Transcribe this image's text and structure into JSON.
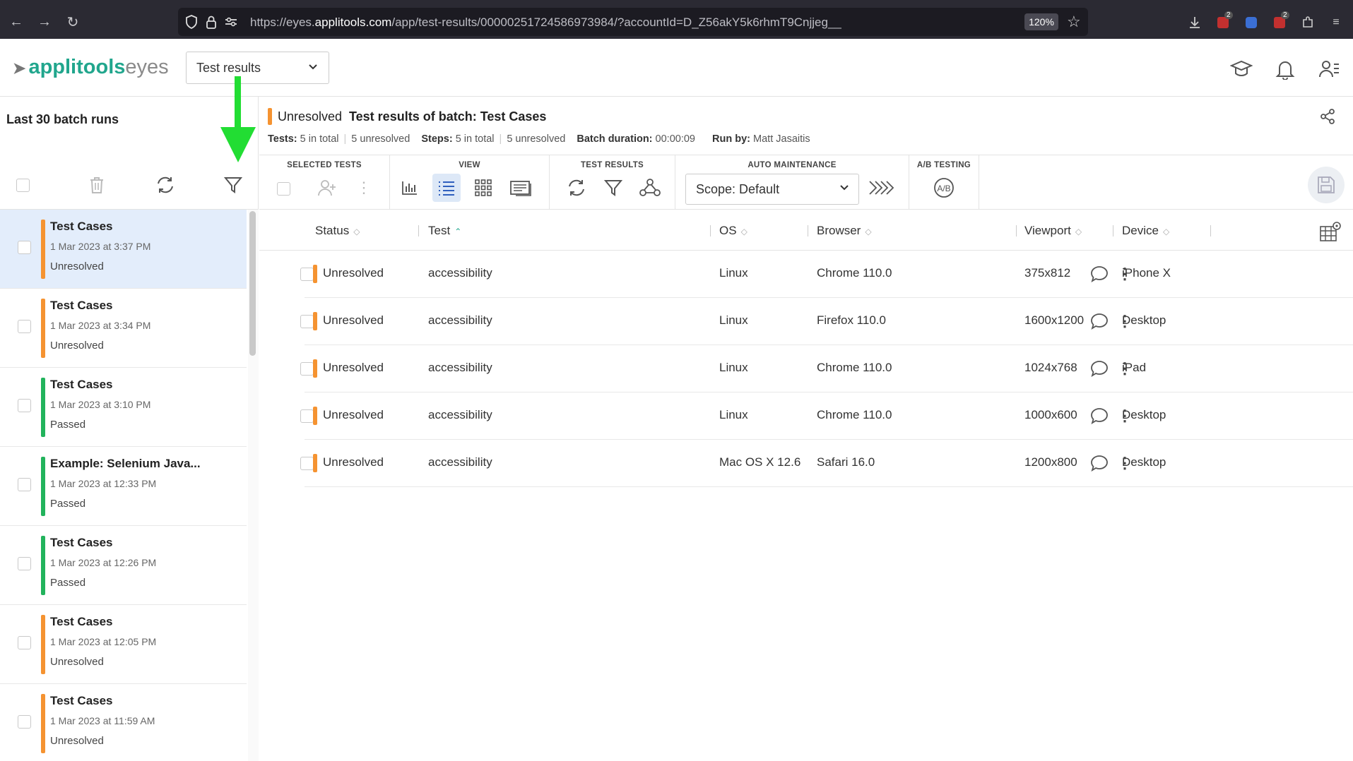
{
  "browser": {
    "url_prefix": "https://eyes.",
    "url_domain": "applitools.com",
    "url_rest": "/app/test-results/00000251724586973984/?accountId=D_Z56akY5k6rhmT9Cnjjeg__",
    "zoom": "120%",
    "ext_badge_1": "2",
    "ext_badge_2": "2"
  },
  "header": {
    "logo_main": "applitools",
    "logo_sub": "eyes",
    "view_select": "Test results"
  },
  "sidebar": {
    "title": "Last 30 batch runs",
    "batches": [
      {
        "name": "Test Cases",
        "date": "1 Mar 2023 at 3:37 PM",
        "status": "Unresolved",
        "color": "#f59331",
        "selected": true
      },
      {
        "name": "Test Cases",
        "date": "1 Mar 2023 at 3:34 PM",
        "status": "Unresolved",
        "color": "#f59331",
        "selected": false
      },
      {
        "name": "Test Cases",
        "date": "1 Mar 2023 at 3:10 PM",
        "status": "Passed",
        "color": "#22b35c",
        "selected": false
      },
      {
        "name": "Example: Selenium Java...",
        "date": "1 Mar 2023 at 12:33 PM",
        "status": "Passed",
        "color": "#22b35c",
        "selected": false
      },
      {
        "name": "Test Cases",
        "date": "1 Mar 2023 at 12:26 PM",
        "status": "Passed",
        "color": "#22b35c",
        "selected": false
      },
      {
        "name": "Test Cases",
        "date": "1 Mar 2023 at 12:05 PM",
        "status": "Unresolved",
        "color": "#f59331",
        "selected": false
      },
      {
        "name": "Test Cases",
        "date": "1 Mar 2023 at 11:59 AM",
        "status": "Unresolved",
        "color": "#f59331",
        "selected": false
      }
    ]
  },
  "batch_header": {
    "status": "Unresolved",
    "title": "Test results of batch:  Test Cases",
    "tests_label": "Tests:",
    "tests_total": "5 in total",
    "tests_unresolved": "5 unresolved",
    "steps_label": "Steps:",
    "steps_total": "5 in total",
    "steps_unresolved": "5 unresolved",
    "duration_label": "Batch duration:",
    "duration": "00:00:09",
    "runby_label": "Run by:",
    "runby": "Matt Jasaitis"
  },
  "toolbar": {
    "selected_tests": "SELECTED TESTS",
    "view": "VIEW",
    "test_results": "TEST RESULTS",
    "auto_maintenance": "AUTO MAINTENANCE",
    "ab_testing": "A/B TESTING",
    "scope": "Scope: Default",
    "ab_icon_text": "A/B"
  },
  "table": {
    "columns": [
      "Status",
      "Test",
      "OS",
      "Browser",
      "Viewport",
      "Device"
    ],
    "rows": [
      {
        "status": "Unresolved",
        "test": "accessibility",
        "os": "Linux",
        "browser": "Chrome 110.0",
        "viewport": "375x812",
        "device": "iPhone X"
      },
      {
        "status": "Unresolved",
        "test": "accessibility",
        "os": "Linux",
        "browser": "Firefox 110.0",
        "viewport": "1600x1200",
        "device": "Desktop"
      },
      {
        "status": "Unresolved",
        "test": "accessibility",
        "os": "Linux",
        "browser": "Chrome 110.0",
        "viewport": "1024x768",
        "device": "iPad"
      },
      {
        "status": "Unresolved",
        "test": "accessibility",
        "os": "Linux",
        "browser": "Chrome 110.0",
        "viewport": "1000x600",
        "device": "Desktop"
      },
      {
        "status": "Unresolved",
        "test": "accessibility",
        "os": "Mac OS X 12.6",
        "browser": "Safari 16.0",
        "viewport": "1200x800",
        "device": "Desktop"
      }
    ]
  },
  "colors": {
    "unresolved": "#f59331",
    "passed": "#22b35c",
    "brand": "#21a68d",
    "annotation_arrow": "#22dd33"
  },
  "icons": [
    "back-icon",
    "forward-icon",
    "reload-icon",
    "shield-icon",
    "lock-icon",
    "permissions-icon",
    "star-icon",
    "download-icon",
    "graduation-cap-icon",
    "bell-icon",
    "user-settings-icon",
    "trash-icon",
    "refresh-icon",
    "filter-icon",
    "share-icon",
    "assign-user-icon",
    "more-icon",
    "bar-chart-icon",
    "list-view-icon",
    "grid-view-icon",
    "compare-view-icon",
    "branch-icon",
    "accept-all-icon",
    "ab-icon",
    "save-icon",
    "column-settings-icon",
    "comment-icon"
  ]
}
